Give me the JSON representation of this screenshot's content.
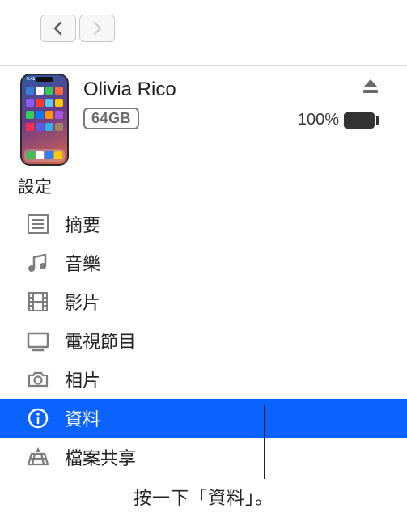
{
  "device": {
    "name": "Olivia Rico",
    "storage_label": "64GB",
    "battery_percent": "100%"
  },
  "section_title": "設定",
  "sidebar": {
    "items": [
      {
        "label": "摘要",
        "icon": "summary"
      },
      {
        "label": "音樂",
        "icon": "music"
      },
      {
        "label": "影片",
        "icon": "movies"
      },
      {
        "label": "電視節目",
        "icon": "tv"
      },
      {
        "label": "相片",
        "icon": "photos"
      },
      {
        "label": "資料",
        "icon": "info",
        "selected": true
      },
      {
        "label": "檔案共享",
        "icon": "apps"
      }
    ]
  },
  "caption": "按一下「資料」。"
}
